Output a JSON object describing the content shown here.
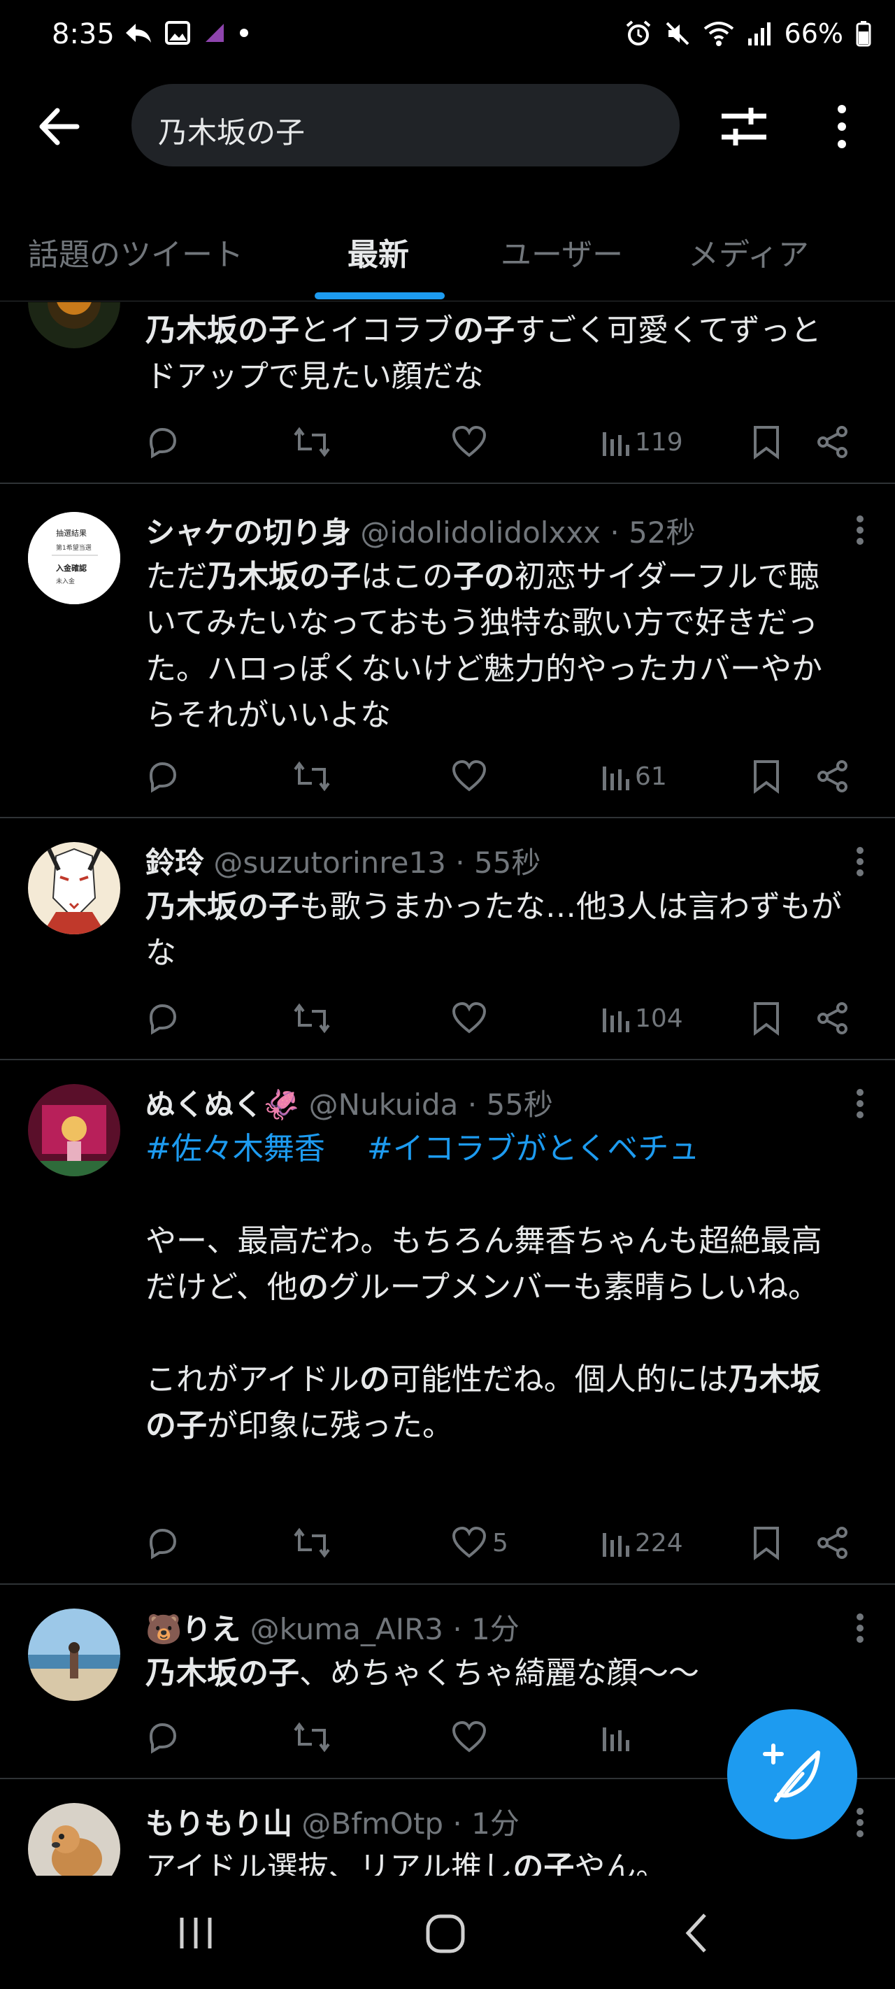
{
  "status_bar": {
    "time": "8:35",
    "battery": "66%"
  },
  "search": {
    "query": "乃木坂の子"
  },
  "tabs": [
    {
      "label": "話題のツイート",
      "active": false
    },
    {
      "label": "最新",
      "active": true
    },
    {
      "label": "ユーザー",
      "active": false
    },
    {
      "label": "メディア",
      "active": false
    }
  ],
  "tweets": [
    {
      "body_html": "<b>乃木坂の子</b>とイコラブ<b>の子</b>すごく可愛くてずっとドアップで見たい顔だな",
      "views": "119",
      "likes": ""
    },
    {
      "name": "シャケの切り身",
      "handle": "@idolidolidolxxx · 52秒",
      "avatar_lines": [
        "抽選結果",
        "第1希望当選",
        "入金確認",
        "未入金"
      ],
      "body_html": "ただ<b>乃木坂の子</b>はこの<b>子の</b>初恋サイダーフルで聴いてみたいなっておもう独特な歌い方で好きだった。ハロっぽくないけど魅力的やったカバーやからそれがいいよな",
      "views": "61",
      "likes": ""
    },
    {
      "name": "鈴玲",
      "handle": "@suzutorinre13 · 55秒",
      "body_html": "<b>乃木坂の子</b>も歌うまかったな…他3人は言わずもがな",
      "views": "104",
      "likes": ""
    },
    {
      "name": "ぬくぬく🦑",
      "handle": "@Nukuida · 55秒",
      "hashtags": [
        "#佐々木舞香",
        "#イコラブがとくベチュ"
      ],
      "body_html": "やー、最高だわ。もちろん舞香ちゃんも超絶最高だけど、他<b>の</b>グループメンバーも素晴らしいね。<br><br>これがアイドル<b>の</b>可能性だね。個人的には<b>乃木坂の子</b>が印象に残った。",
      "views": "224",
      "likes": "5"
    },
    {
      "name": "🐻りえ",
      "handle": "@kuma_AIR3 · 1分",
      "body_html": "<b>乃木坂の子</b>、めちゃくちゃ綺麗な顔〜〜",
      "views": "",
      "likes": ""
    },
    {
      "name": "もりもり山",
      "handle": "@BfmOtp · 1分",
      "body_html": "アイドル選抜、リアル推し<b>の子</b>やん。"
    }
  ],
  "colors": {
    "accent": "#1d9bf0",
    "muted": "#71767b",
    "divider": "#2f3336"
  }
}
